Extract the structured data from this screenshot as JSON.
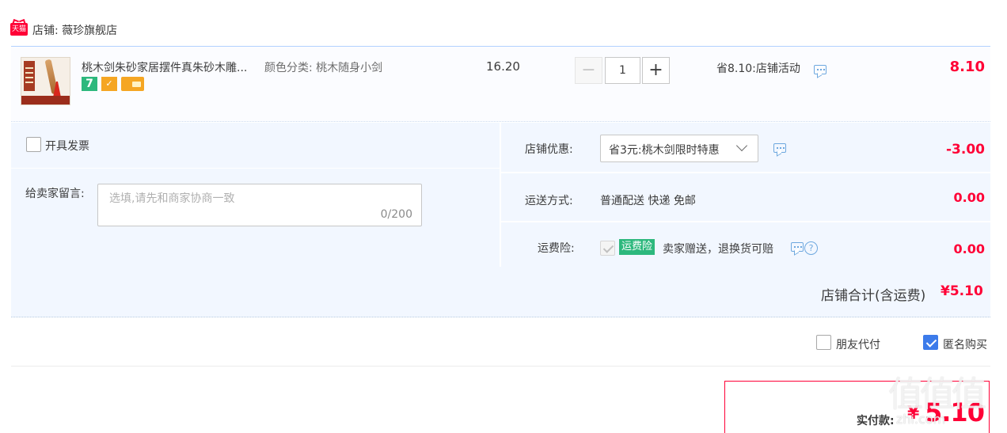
{
  "shop": {
    "badge": "天猫",
    "label": "店铺: 薇珍旗舰店"
  },
  "item": {
    "title": "桃木剑朱砂家居摆件真朱砂木雕...",
    "sku": "颜色分类: 桃木随身小剑",
    "unit_price": "16.20",
    "quantity": "1",
    "minus_label": "−",
    "plus_label": "+",
    "promo": "省8.10:店铺活动",
    "total": "8.10",
    "badge_7": "7"
  },
  "options": {
    "invoice_label": "开具发票",
    "message_label": "给卖家留言:",
    "message_placeholder": "选填,请先和商家协商一致",
    "message_count": "0/200",
    "shop_discount_label": "店铺优惠:",
    "shop_discount_value": "省3元:桃木剑限时特惠",
    "shop_discount_amount": "-3.00",
    "shipping_label": "运送方式:",
    "shipping_value": "普通配送 快递 免邮",
    "shipping_amount": "0.00",
    "insurance_label": "运费险:",
    "insurance_badge": "运费险",
    "insurance_desc": "卖家赠送，退换货可赔",
    "insurance_amount": "0.00",
    "help_glyph": "?"
  },
  "summary": {
    "label": "店铺合计(含运费)",
    "value": "¥5.10"
  },
  "extras": {
    "friend_pay_label": "朋友代付",
    "anonymous_label": "匿名购买",
    "anonymous_checked": true
  },
  "payment": {
    "label": "实付款:",
    "yen": "¥",
    "value": "5.10"
  },
  "watermark": {
    "text": "值值值",
    "url": "zhi.com"
  },
  "colors": {
    "price_red": "#ff0036",
    "panel_blue": "#f2f7ff",
    "accent_green": "#2db87d",
    "checkbox_blue": "#3c7bea"
  }
}
